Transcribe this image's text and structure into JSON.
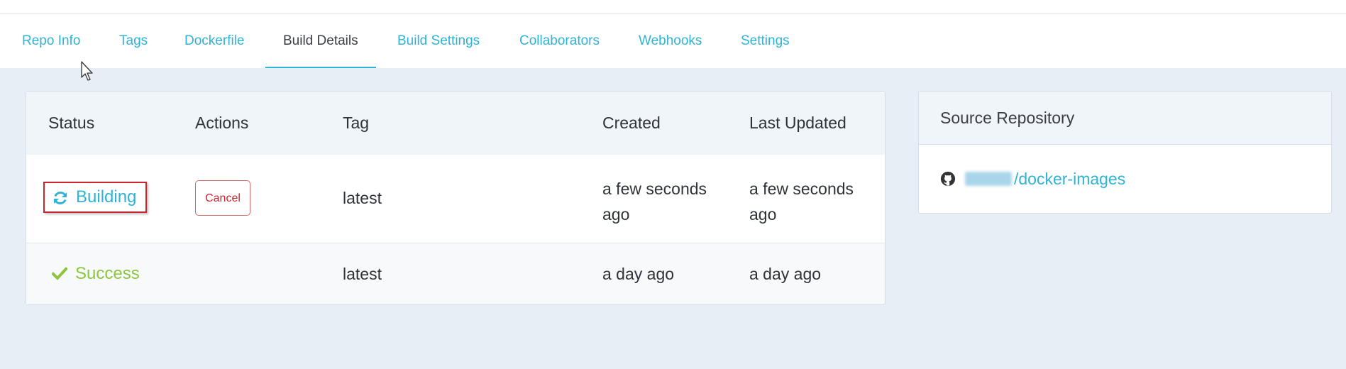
{
  "tabs": [
    {
      "label": "Repo Info"
    },
    {
      "label": "Tags"
    },
    {
      "label": "Dockerfile"
    },
    {
      "label": "Build Details"
    },
    {
      "label": "Build Settings"
    },
    {
      "label": "Collaborators"
    },
    {
      "label": "Webhooks"
    },
    {
      "label": "Settings"
    }
  ],
  "active_tab": "Build Details",
  "table": {
    "headers": [
      "Status",
      "Actions",
      "Tag",
      "Created",
      "Last Updated"
    ],
    "rows": [
      {
        "status": "Building",
        "status_icon": "refresh-icon",
        "status_color": "#2fb3d6",
        "action": "Cancel",
        "tag": "latest",
        "created_line1": "a few seconds",
        "created_line2": "ago",
        "updated_line1": "a few seconds",
        "updated_line2": "ago"
      },
      {
        "status": "Success",
        "status_icon": "checkmark-icon",
        "status_color": "#8cc63f",
        "tag": "latest",
        "created": "a day ago",
        "updated": "a day ago"
      }
    ]
  },
  "source_repository": {
    "title": "Source Repository",
    "icon": "github-icon",
    "repo": "/docker-images"
  },
  "colors": {
    "accent": "#2fb3d6",
    "danger": "#c9252c",
    "success": "#8cc63f",
    "background": "#e8eef5"
  }
}
